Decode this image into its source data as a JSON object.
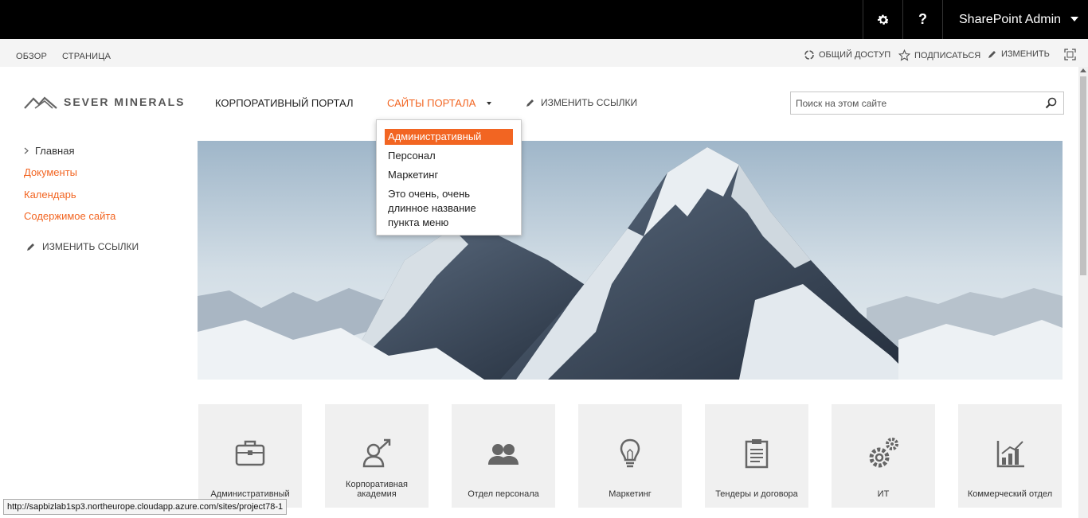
{
  "suitebar": {
    "settings_icon": "gear-icon",
    "help_label": "?",
    "user_name": "SharePoint Admin"
  },
  "ribbon": {
    "tabs": [
      "ОБЗОР",
      "СТРАНИЦА"
    ],
    "share_label": "ОБЩИЙ ДОСТУП",
    "follow_label": "ПОДПИСАТЬСЯ",
    "edit_label": "ИЗМЕНИТЬ"
  },
  "header": {
    "logo_text": "SEVER MINERALS",
    "nav": [
      "КОРПОРАТИВНЫЙ ПОРТАЛ",
      "САЙТЫ ПОРТАЛА"
    ],
    "edit_links": "ИЗМЕНИТЬ ССЫЛКИ",
    "search_placeholder": "Поиск на этом сайте"
  },
  "dropdown": {
    "items": [
      "Административный",
      "Персонал",
      "Маркетинг",
      "Это очень, очень длинное название пункта меню"
    ],
    "selected_index": 0
  },
  "leftnav": {
    "items": [
      "Главная",
      "Документы",
      "Календарь",
      "Содержимое сайта"
    ],
    "edit_links": "ИЗМЕНИТЬ ССЫЛКИ"
  },
  "tiles": [
    {
      "label": "Административный",
      "icon": "briefcase-icon"
    },
    {
      "label": "Корпоративная академия",
      "icon": "person-growth-icon"
    },
    {
      "label": "Отдел персонала",
      "icon": "people-icon"
    },
    {
      "label": "Маркетинг",
      "icon": "lightbulb-icon"
    },
    {
      "label": "Тендеры и договора",
      "icon": "clipboard-icon"
    },
    {
      "label": "ИТ",
      "icon": "gears-icon"
    },
    {
      "label": "Коммерческий отдел",
      "icon": "bar-chart-icon"
    }
  ],
  "statusbar": {
    "url": "http://sapbizlab1sp3.northeurope.cloudapp.azure.com/sites/project78-1"
  },
  "colors": {
    "accent": "#f26522",
    "suitebar": "#000000",
    "tile_bg": "#f0f0f0"
  }
}
